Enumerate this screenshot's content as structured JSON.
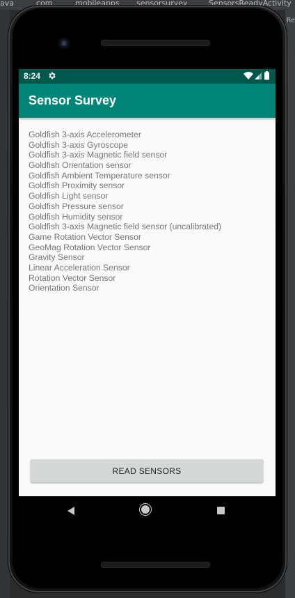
{
  "ide": {
    "tabs": [
      "ava",
      "com",
      "mobileapps",
      "sensorsurvey",
      "SensorsReadyActivity"
    ],
    "right_fragment": "Re"
  },
  "status_bar": {
    "time": "8:24",
    "settings_icon": "gear-icon",
    "wifi_icon": "wifi-icon",
    "signal_icon": "signal-icon",
    "battery_icon": "battery-icon",
    "background": "#00574b"
  },
  "app_bar": {
    "title": "Sensor Survey",
    "background": "#008577"
  },
  "sensors": [
    "Goldfish 3-axis Accelerometer",
    "Goldfish 3-axis Gyroscope",
    "Goldfish 3-axis Magnetic field sensor",
    "Goldfish Orientation sensor",
    "Goldfish Ambient Temperature sensor",
    "Goldfish Proximity sensor",
    "Goldfish Light sensor",
    "Goldfish Pressure sensor",
    "Goldfish Humidity sensor",
    "Goldfish 3-axis Magnetic field sensor (uncalibrated)",
    "Game Rotation Vector Sensor",
    "GeoMag Rotation Vector Sensor",
    "Gravity Sensor",
    "Linear Acceleration Sensor",
    "Rotation Vector Sensor",
    "Orientation Sensor"
  ],
  "actions": {
    "read_sensors_label": "READ SENSORS"
  },
  "navigation": {
    "back_icon": "back-icon",
    "home_icon": "home-icon",
    "recents_icon": "recents-icon"
  }
}
